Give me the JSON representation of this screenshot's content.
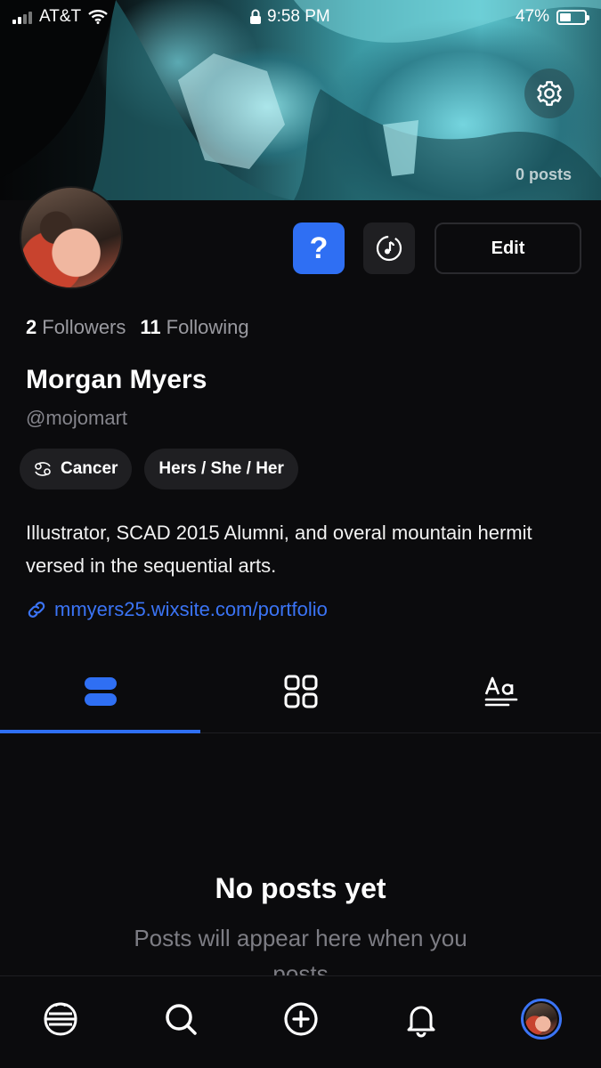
{
  "status_bar": {
    "carrier": "AT&T",
    "time": "9:58 PM",
    "battery": "47%",
    "battery_level": 0.47
  },
  "banner": {
    "posts_count": "0 posts",
    "settings_icon": "gear-icon"
  },
  "profile": {
    "followers_count": "2",
    "followers_label": "Followers",
    "following_count": "11",
    "following_label": "Following",
    "display_name": "Morgan Myers",
    "handle": "@mojomart",
    "chips": {
      "zodiac": "Cancer",
      "pronouns": "Hers / She / Her"
    },
    "bio": "Illustrator, SCAD 2015 Alumni, and overal mountain hermit versed in the sequential arts.",
    "link": "mmyers25.wixsite.com/portfolio"
  },
  "actions": {
    "help_label": "?",
    "edit_label": "Edit"
  },
  "tabs": [
    {
      "icon": "list-view-icon",
      "active": true
    },
    {
      "icon": "grid-view-icon",
      "active": false
    },
    {
      "icon": "text-view-icon",
      "active": false
    }
  ],
  "empty_state": {
    "title": "No posts yet",
    "subtitle": "Posts will appear here when you posts"
  },
  "colors": {
    "accent": "#2f6ff3",
    "link": "#3b74f5",
    "background": "#0b0b0d",
    "chip": "#1f1f22"
  }
}
